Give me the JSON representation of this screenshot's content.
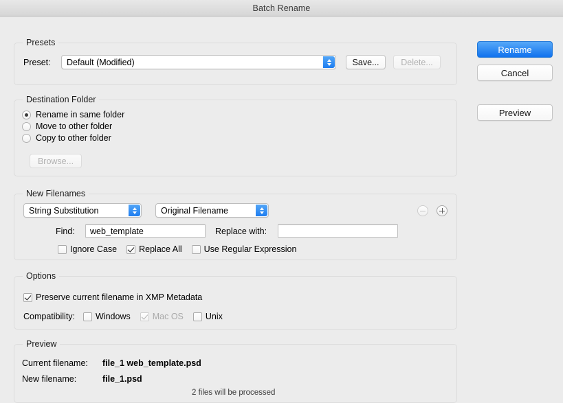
{
  "window": {
    "title": "Batch Rename"
  },
  "action_buttons": {
    "rename": "Rename",
    "cancel": "Cancel",
    "preview": "Preview"
  },
  "presets": {
    "group_title": "Presets",
    "preset_label": "Preset:",
    "preset_value": "Default (Modified)",
    "save_button": "Save...",
    "delete_button": "Delete..."
  },
  "destination": {
    "group_title": "Destination Folder",
    "options": [
      {
        "label": "Rename in same folder",
        "checked": true
      },
      {
        "label": "Move to other folder",
        "checked": false
      },
      {
        "label": "Copy to other folder",
        "checked": false
      }
    ],
    "browse_button": "Browse..."
  },
  "new_filenames": {
    "group_title": "New Filenames",
    "method_select": "String Substitution",
    "source_select": "Original Filename",
    "find_label": "Find:",
    "find_value": "web_template",
    "replace_label": "Replace with:",
    "replace_value": "",
    "checkboxes": [
      {
        "label": "Ignore Case",
        "checked": false
      },
      {
        "label": "Replace All",
        "checked": true
      },
      {
        "label": "Use Regular Expression",
        "checked": false
      }
    ],
    "remove_icon": "minus-circle-icon",
    "add_icon": "plus-circle-icon"
  },
  "options": {
    "group_title": "Options",
    "preserve_label": "Preserve current filename in XMP Metadata",
    "preserve_checked": true,
    "compatibility_label": "Compatibility:",
    "compatibility": [
      {
        "label": "Windows",
        "checked": false,
        "disabled": false
      },
      {
        "label": "Mac OS",
        "checked": true,
        "disabled": true
      },
      {
        "label": "Unix",
        "checked": false,
        "disabled": false
      }
    ]
  },
  "preview": {
    "group_title": "Preview",
    "current_label": "Current filename:",
    "current_value": "file_1 web_template.psd",
    "new_label": "New filename:",
    "new_value": "file_1.psd",
    "status": "2 files will be processed"
  },
  "colors": {
    "accent": "#1172ee",
    "window_bg": "#ececec",
    "group_border": "#dcdcdc"
  }
}
